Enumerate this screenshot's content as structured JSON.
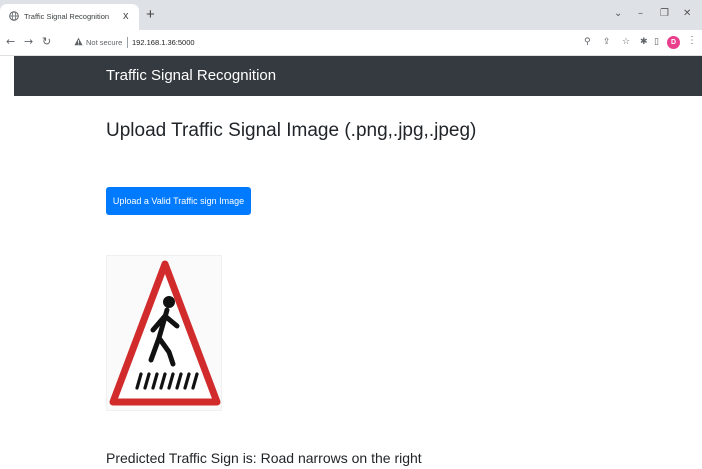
{
  "browser": {
    "tab_title": "Traffic Signal Recognition",
    "tab_close": "x",
    "new_tab": "+",
    "not_secure": "Not secure",
    "url": "192.168.1.36:5000",
    "profile_initial": "D"
  },
  "app": {
    "brand": "Traffic Signal Recognition",
    "heading": "Upload Traffic Signal Image (.png,.jpg,.jpeg)",
    "upload_button": "Upload a Valid Traffic sign Image",
    "prediction": "Predicted Traffic Sign is: Road narrows on the right"
  },
  "icons": [
    "globe-icon",
    "back-arrow-icon",
    "forward-arrow-icon",
    "reload-icon",
    "warning-icon",
    "zoom-icon",
    "share-icon",
    "star-icon",
    "extensions-icon",
    "sidebar-icon",
    "menu-icon"
  ],
  "colors": {
    "navbar": "#343a40",
    "button": "#007bff",
    "sign_red": "#d12b2b"
  }
}
